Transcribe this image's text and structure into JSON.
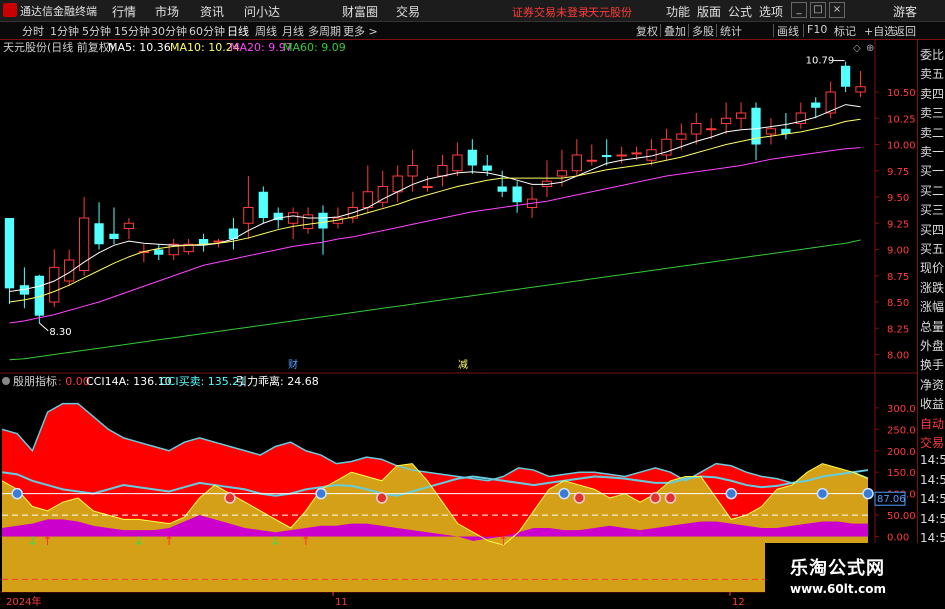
{
  "app": {
    "title": "通达信金融终端"
  },
  "menu": [
    "行情",
    "市场",
    "资讯",
    "问小达",
    "财富圈",
    "交易"
  ],
  "notice": "证券交易未登录",
  "stock_name_top": "天元股份",
  "right_menu": [
    "功能",
    "版面",
    "公式",
    "选项",
    "游客"
  ],
  "window_buttons": [
    "_",
    "□",
    "×"
  ],
  "periods": [
    {
      "label": "分时"
    },
    {
      "label": "1分钟"
    },
    {
      "label": "5分钟"
    },
    {
      "label": "15分钟"
    },
    {
      "label": "30分钟"
    },
    {
      "label": "60分钟"
    },
    {
      "label": "日线",
      "active": true
    },
    {
      "label": "周线"
    },
    {
      "label": "月线"
    },
    {
      "label": "多周期"
    },
    {
      "label": "更多 >"
    }
  ],
  "tools": [
    "复权",
    "叠加",
    "多股",
    "统计",
    "画线",
    "F10",
    "标记",
    "+自选",
    "返回"
  ],
  "chart_header": {
    "name": "天元股份(日线 前复权)",
    "ma5": "MA5: 10.36",
    "ma10": "MA10: 10.24",
    "ma20": "MA20: 9.97",
    "ma60": "MA60: 9.09"
  },
  "indicator_header": {
    "name": "殷朋指标",
    "v0": ": 0.00",
    "cci14a": "CCI14A: 136.10",
    "cci_mm": "CCI买卖: 135.21",
    "pull": "引力乖离: 24.68"
  },
  "annotations": {
    "high": "10.79",
    "low": "8.30",
    "cai": "财",
    "jian": "减",
    "cur_val": "87.06"
  },
  "x_axis": {
    "labels": [
      "2024年",
      "11",
      "12"
    ]
  },
  "right_panel": [
    "委比",
    "卖五",
    "卖四",
    "卖三",
    "卖二",
    "卖一",
    "买一",
    "买二",
    "买三",
    "买四",
    "买五",
    "现价",
    "涨跌",
    "涨幅",
    "总量",
    "外盘",
    "换手",
    "净资",
    "收益",
    "自动",
    "交易",
    "14:56",
    "14:56",
    "14:56",
    "14:56",
    "14:56",
    "14:56",
    "14:56",
    "14:56"
  ],
  "watermark": {
    "title": "乐淘公式网",
    "url": "www.60lt.com"
  },
  "colors": {
    "up": "#ff3b3b",
    "down": "#54ffff",
    "ma5": "#ffffff",
    "ma10": "#ffff66",
    "ma20": "#ff44ff",
    "ma60": "#33cc33",
    "fill_red": "#ff0000",
    "fill_gold": "#d4a017",
    "fill_magenta": "#cc00cc"
  },
  "chart_data": {
    "type": "candlestick",
    "ylim": [
      7.9,
      10.9
    ],
    "y_ticks": [
      "10.50",
      "10.25",
      "10.00",
      "9.75",
      "9.50",
      "9.25",
      "9.00",
      "8.75",
      "8.50",
      "8.25",
      "8.00"
    ],
    "candles": [
      [
        9.3,
        8.63,
        9.3,
        8.48
      ],
      [
        8.66,
        8.57,
        8.83,
        8.44
      ],
      [
        8.75,
        8.37,
        8.76,
        8.3
      ],
      [
        8.5,
        8.83,
        9.0,
        8.45
      ],
      [
        8.7,
        8.9,
        9.0,
        8.65
      ],
      [
        8.8,
        9.3,
        9.5,
        8.75
      ],
      [
        9.25,
        9.05,
        9.45,
        9.0
      ],
      [
        9.15,
        9.1,
        9.4,
        9.05
      ],
      [
        9.2,
        9.25,
        9.3,
        9.1
      ],
      [
        8.97,
        8.98,
        9.05,
        8.88
      ],
      [
        9.0,
        8.95,
        9.05,
        8.9
      ],
      [
        8.95,
        9.05,
        9.1,
        8.9
      ],
      [
        8.98,
        9.05,
        9.1,
        8.95
      ],
      [
        9.1,
        9.05,
        9.15,
        8.98
      ],
      [
        9.08,
        9.08,
        9.1,
        9.02
      ],
      [
        9.2,
        9.1,
        9.3,
        9.0
      ],
      [
        9.25,
        9.4,
        9.7,
        9.1
      ],
      [
        9.55,
        9.3,
        9.6,
        9.25
      ],
      [
        9.35,
        9.28,
        9.4,
        9.2
      ],
      [
        9.25,
        9.35,
        9.4,
        9.1
      ],
      [
        9.2,
        9.33,
        9.4,
        9.15
      ],
      [
        9.35,
        9.2,
        9.42,
        8.95
      ],
      [
        9.25,
        9.3,
        9.4,
        9.2
      ],
      [
        9.3,
        9.4,
        9.55,
        9.25
      ],
      [
        9.4,
        9.55,
        9.8,
        9.35
      ],
      [
        9.45,
        9.6,
        9.75,
        9.4
      ],
      [
        9.55,
        9.7,
        9.8,
        9.45
      ],
      [
        9.7,
        9.8,
        9.95,
        9.55
      ],
      [
        9.6,
        9.6,
        9.7,
        9.55
      ],
      [
        9.7,
        9.8,
        9.9,
        9.6
      ],
      [
        9.75,
        9.9,
        10.02,
        9.7
      ],
      [
        9.95,
        9.8,
        10.05,
        9.72
      ],
      [
        9.8,
        9.75,
        9.9,
        9.7
      ],
      [
        9.6,
        9.55,
        9.75,
        9.5
      ],
      [
        9.6,
        9.45,
        9.65,
        9.35
      ],
      [
        9.4,
        9.48,
        9.6,
        9.3
      ],
      [
        9.6,
        9.65,
        9.85,
        9.5
      ],
      [
        9.7,
        9.75,
        9.95,
        9.6
      ],
      [
        9.75,
        9.9,
        10.05,
        9.7
      ],
      [
        9.85,
        9.85,
        10.0,
        9.8
      ],
      [
        9.9,
        9.88,
        10.05,
        9.8
      ],
      [
        9.9,
        9.9,
        9.98,
        9.82
      ],
      [
        9.92,
        9.92,
        9.98,
        9.85
      ],
      [
        9.85,
        9.95,
        10.05,
        9.8
      ],
      [
        9.9,
        10.05,
        10.15,
        9.85
      ],
      [
        10.05,
        10.1,
        10.2,
        9.95
      ],
      [
        10.1,
        10.2,
        10.3,
        10.0
      ],
      [
        10.15,
        10.15,
        10.25,
        10.05
      ],
      [
        10.2,
        10.25,
        10.4,
        10.1
      ],
      [
        10.25,
        10.3,
        10.4,
        10.15
      ],
      [
        10.35,
        10.0,
        10.4,
        9.85
      ],
      [
        10.1,
        10.15,
        10.25,
        10.0
      ],
      [
        10.15,
        10.1,
        10.3,
        10.05
      ],
      [
        10.2,
        10.3,
        10.4,
        10.15
      ],
      [
        10.4,
        10.35,
        10.45,
        10.25
      ],
      [
        10.3,
        10.5,
        10.6,
        10.25
      ],
      [
        10.75,
        10.55,
        10.79,
        10.5
      ],
      [
        10.5,
        10.55,
        10.7,
        10.45
      ]
    ],
    "ma_series": {
      "ma5": [
        8.6,
        8.62,
        8.65,
        8.7,
        8.78,
        8.88,
        8.97,
        9.04,
        9.08,
        9.06,
        9.05,
        9.04,
        9.04,
        9.04,
        9.06,
        9.1,
        9.18,
        9.25,
        9.3,
        9.32,
        9.3,
        9.3,
        9.31,
        9.35,
        9.4,
        9.48,
        9.55,
        9.62,
        9.67,
        9.7,
        9.73,
        9.74,
        9.73,
        9.7,
        9.66,
        9.62,
        9.62,
        9.64,
        9.7,
        9.76,
        9.82,
        9.85,
        9.87,
        9.89,
        9.93,
        9.98,
        10.03,
        10.07,
        10.12,
        10.14,
        10.15,
        10.17,
        10.19,
        10.22,
        10.26,
        10.32,
        10.38,
        10.36
      ],
      "ma10": [
        8.5,
        8.52,
        8.55,
        8.6,
        8.66,
        8.73,
        8.8,
        8.87,
        8.93,
        8.98,
        9.01,
        9.03,
        9.04,
        9.05,
        9.06,
        9.08,
        9.11,
        9.15,
        9.19,
        9.22,
        9.24,
        9.26,
        9.28,
        9.31,
        9.35,
        9.39,
        9.43,
        9.48,
        9.52,
        9.56,
        9.6,
        9.63,
        9.66,
        9.68,
        9.68,
        9.68,
        9.68,
        9.68,
        9.7,
        9.73,
        9.76,
        9.78,
        9.8,
        9.82,
        9.85,
        9.88,
        9.92,
        9.96,
        10.0,
        10.03,
        10.06,
        10.08,
        10.1,
        10.12,
        10.15,
        10.18,
        10.22,
        10.24
      ],
      "ma20": [
        8.3,
        8.32,
        8.35,
        8.38,
        8.42,
        8.46,
        8.5,
        8.55,
        8.6,
        8.65,
        8.7,
        8.75,
        8.8,
        8.85,
        8.88,
        8.91,
        8.94,
        8.97,
        9.0,
        9.03,
        9.05,
        9.07,
        9.1,
        9.12,
        9.15,
        9.18,
        9.21,
        9.24,
        9.27,
        9.3,
        9.33,
        9.36,
        9.38,
        9.4,
        9.42,
        9.44,
        9.46,
        9.49,
        9.52,
        9.55,
        9.58,
        9.61,
        9.64,
        9.67,
        9.7,
        9.72,
        9.74,
        9.76,
        9.78,
        9.8,
        9.83,
        9.86,
        9.88,
        9.9,
        9.92,
        9.94,
        9.96,
        9.97
      ],
      "ma60": [
        7.95,
        7.96,
        7.98,
        8.0,
        8.02,
        8.04,
        8.06,
        8.08,
        8.1,
        8.12,
        8.14,
        8.16,
        8.18,
        8.2,
        8.22,
        8.24,
        8.26,
        8.28,
        8.3,
        8.32,
        8.34,
        8.36,
        8.38,
        8.4,
        8.42,
        8.44,
        8.46,
        8.48,
        8.5,
        8.52,
        8.54,
        8.56,
        8.58,
        8.6,
        8.62,
        8.64,
        8.66,
        8.68,
        8.7,
        8.72,
        8.74,
        8.76,
        8.78,
        8.8,
        8.82,
        8.84,
        8.86,
        8.88,
        8.9,
        8.92,
        8.94,
        8.96,
        8.98,
        9.0,
        9.02,
        9.04,
        9.06,
        9.09
      ]
    },
    "indicator": {
      "ylim": [
        -120,
        330
      ],
      "y_ticks": [
        "300.0",
        "250.0",
        "200.0",
        "150.0",
        "100.0",
        "50.00",
        "0.00"
      ],
      "red": [
        250,
        240,
        200,
        290,
        310,
        310,
        280,
        250,
        230,
        220,
        210,
        200,
        220,
        230,
        220,
        210,
        200,
        190,
        210,
        220,
        200,
        190,
        170,
        175,
        185,
        180,
        165,
        155,
        150,
        145,
        140,
        135,
        130,
        140,
        160,
        155,
        140,
        145,
        150,
        150,
        145,
        140,
        150,
        160,
        150,
        130,
        150,
        170,
        165,
        150,
        140,
        135,
        125,
        130,
        140,
        145,
        150,
        136
      ],
      "gold": [
        130,
        110,
        70,
        60,
        80,
        90,
        60,
        50,
        40,
        40,
        35,
        30,
        45,
        90,
        120,
        100,
        80,
        60,
        40,
        20,
        60,
        110,
        130,
        150,
        140,
        130,
        165,
        170,
        130,
        80,
        30,
        10,
        -10,
        -20,
        10,
        60,
        110,
        130,
        120,
        110,
        90,
        100,
        80,
        100,
        130,
        140,
        140,
        90,
        40,
        50,
        70,
        110,
        120,
        150,
        170,
        160,
        150,
        135
      ],
      "magenta": [
        20,
        25,
        30,
        40,
        40,
        35,
        25,
        20,
        15,
        15,
        15,
        20,
        35,
        50,
        40,
        30,
        20,
        15,
        10,
        15,
        20,
        25,
        25,
        30,
        30,
        25,
        20,
        15,
        10,
        5,
        0,
        -10,
        -5,
        0,
        10,
        20,
        20,
        15,
        15,
        20,
        25,
        20,
        15,
        20,
        25,
        30,
        35,
        35,
        30,
        25,
        20,
        20,
        25,
        30,
        35,
        35,
        30,
        30
      ],
      "cyan": [
        150,
        145,
        130,
        120,
        110,
        105,
        100,
        110,
        120,
        115,
        110,
        105,
        115,
        125,
        120,
        115,
        110,
        100,
        95,
        100,
        110,
        115,
        120,
        118,
        110,
        100,
        95,
        105,
        115,
        125,
        135,
        140,
        135,
        130,
        125,
        120,
        125,
        130,
        135,
        140,
        138,
        135,
        130,
        125,
        125,
        135,
        140,
        138,
        130,
        120,
        115,
        118,
        125,
        130,
        140,
        145,
        150,
        155
      ]
    }
  }
}
